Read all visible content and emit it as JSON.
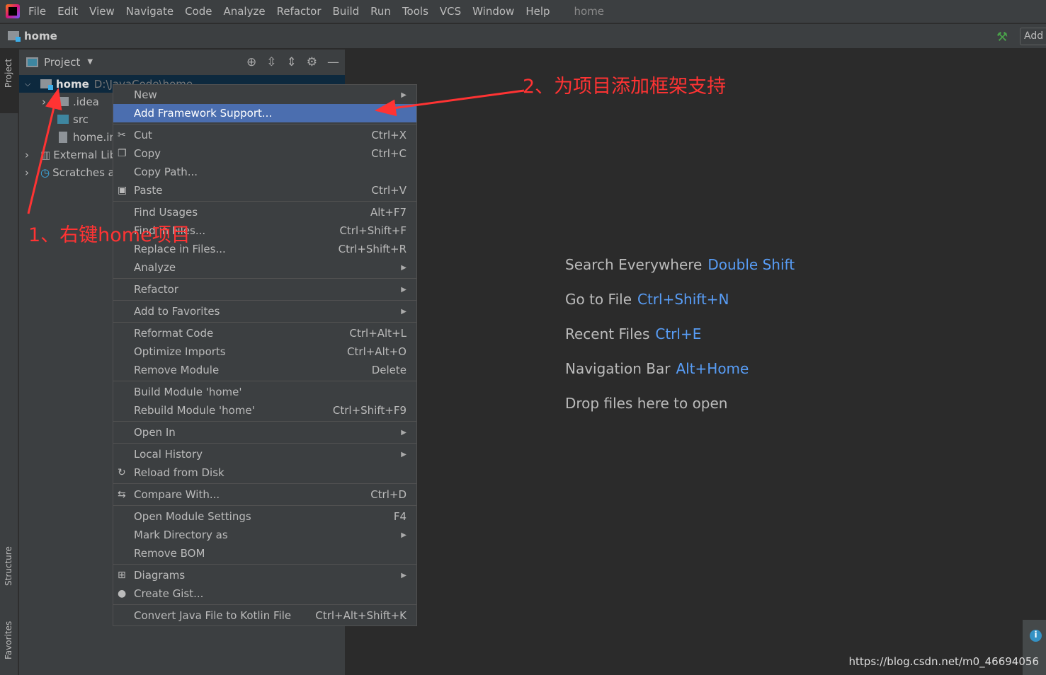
{
  "menubar": {
    "items": [
      "File",
      "Edit",
      "View",
      "Navigate",
      "Code",
      "Analyze",
      "Refactor",
      "Build",
      "Run",
      "Tools",
      "VCS",
      "Window",
      "Help"
    ],
    "title": "home"
  },
  "navbar": {
    "project": "home",
    "add_config": "Add"
  },
  "left_strip": {
    "project": "Project",
    "structure": "Structure",
    "favorites": "Favorites"
  },
  "project_panel": {
    "title": "Project",
    "tree": [
      {
        "label": "home",
        "path": "D:\\JavaCode\\home"
      },
      {
        "label": ".idea"
      },
      {
        "label": "src"
      },
      {
        "label": "home.iml"
      },
      {
        "label": "External Libraries"
      },
      {
        "label": "Scratches and Consoles"
      }
    ]
  },
  "context_menu": {
    "groups": [
      [
        {
          "label": "New",
          "submenu": true
        },
        {
          "label": "Add Framework Support...",
          "highlighted": true
        }
      ],
      [
        {
          "label": "Cut",
          "shortcut": "Ctrl+X",
          "icon": "scissors-icon"
        },
        {
          "label": "Copy",
          "shortcut": "Ctrl+C",
          "icon": "copy-icon"
        },
        {
          "label": "Copy Path..."
        },
        {
          "label": "Paste",
          "shortcut": "Ctrl+V",
          "icon": "paste-icon"
        }
      ],
      [
        {
          "label": "Find Usages",
          "shortcut": "Alt+F7"
        },
        {
          "label": "Find in Files...",
          "shortcut": "Ctrl+Shift+F"
        },
        {
          "label": "Replace in Files...",
          "shortcut": "Ctrl+Shift+R"
        },
        {
          "label": "Analyze",
          "submenu": true
        }
      ],
      [
        {
          "label": "Refactor",
          "submenu": true
        }
      ],
      [
        {
          "label": "Add to Favorites",
          "submenu": true
        }
      ],
      [
        {
          "label": "Reformat Code",
          "shortcut": "Ctrl+Alt+L"
        },
        {
          "label": "Optimize Imports",
          "shortcut": "Ctrl+Alt+O"
        },
        {
          "label": "Remove Module",
          "shortcut": "Delete"
        }
      ],
      [
        {
          "label": "Build Module 'home'"
        },
        {
          "label": "Rebuild Module 'home'",
          "shortcut": "Ctrl+Shift+F9"
        }
      ],
      [
        {
          "label": "Open In",
          "submenu": true
        }
      ],
      [
        {
          "label": "Local History",
          "submenu": true
        },
        {
          "label": "Reload from Disk",
          "icon": "reload-icon"
        }
      ],
      [
        {
          "label": "Compare With...",
          "shortcut": "Ctrl+D",
          "icon": "compare-icon"
        }
      ],
      [
        {
          "label": "Open Module Settings",
          "shortcut": "F4"
        },
        {
          "label": "Mark Directory as",
          "submenu": true
        },
        {
          "label": "Remove BOM"
        }
      ],
      [
        {
          "label": "Diagrams",
          "submenu": true,
          "icon": "diagram-icon"
        },
        {
          "label": "Create Gist...",
          "icon": "github-icon"
        }
      ],
      [
        {
          "label": "Convert Java File to Kotlin File",
          "shortcut": "Ctrl+Alt+Shift+K"
        }
      ]
    ]
  },
  "editor_hints": [
    {
      "label": "Search Everywhere",
      "key": "Double Shift"
    },
    {
      "label": "Go to File",
      "key": "Ctrl+Shift+N"
    },
    {
      "label": "Recent Files",
      "key": "Ctrl+E"
    },
    {
      "label": "Navigation Bar",
      "key": "Alt+Home"
    },
    {
      "label": "Drop files here to open",
      "key": ""
    }
  ],
  "annotations": {
    "step1": "1、右键home项目",
    "step2": "2、为项目添加框架支持",
    "color": "#ff3333"
  },
  "watermark": "https://blog.csdn.net/m0_46694056"
}
